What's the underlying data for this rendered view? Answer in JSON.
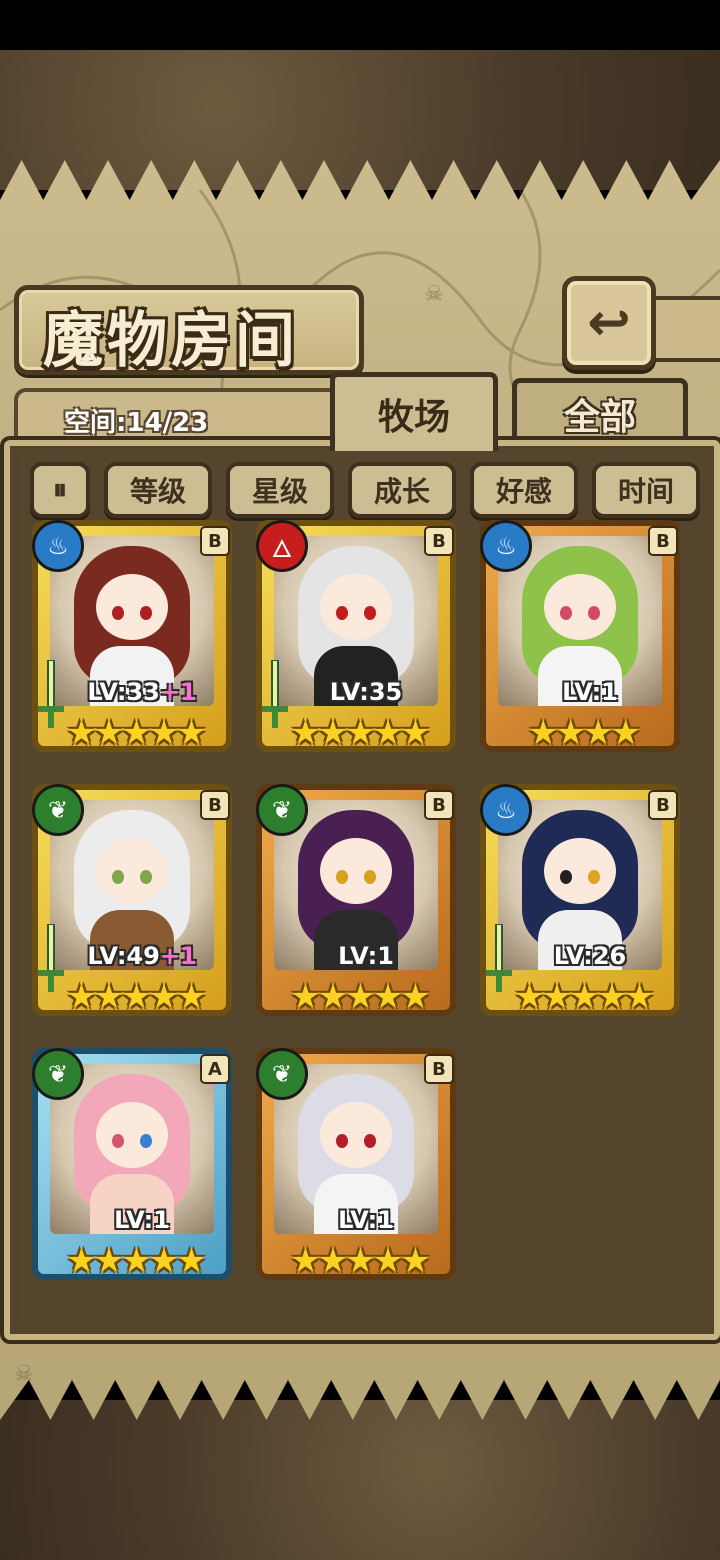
{
  "title": "魔物房间",
  "back_icon": "↩",
  "space_label": "空间:14/23",
  "tabs": [
    {
      "label": "牧场",
      "active": true
    },
    {
      "label": "全部",
      "active": false
    }
  ],
  "filters": {
    "pause_icon": "⏸",
    "labels": [
      "等级",
      "星级",
      "成长",
      "好感",
      "时间"
    ]
  },
  "cards": [
    {
      "element_icon": "♨",
      "element": "water",
      "rank": "B",
      "level": "LV:33",
      "bonus": "+1",
      "stars": "★★★★★",
      "frame": "gold"
    },
    {
      "element_icon": "🜂",
      "element": "fire",
      "rank": "B",
      "level": "LV:35",
      "bonus": "",
      "stars": "★★★★★",
      "frame": "gold"
    },
    {
      "element_icon": "♨",
      "element": "water",
      "rank": "B",
      "level": "LV:1",
      "bonus": "",
      "stars": "★★★★",
      "frame": "orange"
    },
    {
      "element_icon": "❦",
      "element": "wood",
      "rank": "B",
      "level": "LV:49",
      "bonus": "+1",
      "stars": "★★★★★",
      "frame": "gold"
    },
    {
      "element_icon": "❦",
      "element": "wood",
      "rank": "B",
      "level": "LV:1",
      "bonus": "",
      "stars": "★★★★★",
      "frame": "orange"
    },
    {
      "element_icon": "♨",
      "element": "water",
      "rank": "B",
      "level": "LV:26",
      "bonus": "",
      "stars": "★★★★★",
      "frame": "gold"
    },
    {
      "element_icon": "❦",
      "element": "wood",
      "rank": "A",
      "level": "LV:1",
      "bonus": "",
      "stars": "★★★★★",
      "frame": "blue"
    },
    {
      "element_icon": "❦",
      "element": "wood",
      "rank": "B",
      "level": "LV:1",
      "bonus": "",
      "stars": "★★★★★",
      "frame": "orange"
    }
  ],
  "colors": {
    "parchment": "#c3b283",
    "panel": "#55452d",
    "water": "#2a7bc6",
    "fire": "#c81d1d",
    "wood": "#2d7e2d"
  }
}
